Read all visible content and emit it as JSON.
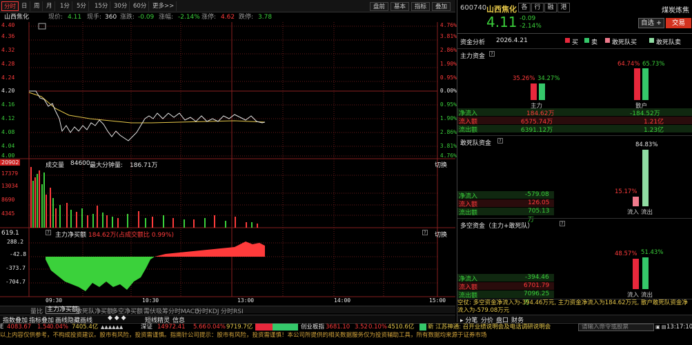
{
  "period_tabs": [
    "分时",
    "日",
    "周",
    "月",
    "1分",
    "5分",
    "15分",
    "30分",
    "60分",
    "更多>>"
  ],
  "period_active": 0,
  "toolbar_right": [
    "盘前",
    "基本",
    "指标",
    "叠加"
  ],
  "info": {
    "name": "山西焦化",
    "price_label": "现价:",
    "price": "4.11",
    "vol_label": "现手:",
    "vol": "360",
    "chg_label": "涨跌:",
    "chg": "-0.09",
    "pct_label": "涨幅:",
    "pct": "-2.14%",
    "up_label": "涨停:",
    "up": "4.62",
    "down_label": "跌停:",
    "down": "3.78"
  },
  "price_axis_left": [
    "4.40",
    "4.36",
    "4.32",
    "4.28",
    "4.24",
    "4.20",
    "4.16",
    "4.12",
    "4.08",
    "4.04",
    "4.00"
  ],
  "price_axis_right": [
    "4.76%",
    "3.81%",
    "2.86%",
    "1.90%",
    "0.95%",
    "0.00%",
    "0.95%",
    "1.90%",
    "2.86%",
    "3.81%",
    "4.76%"
  ],
  "volume_panel": {
    "title_label": "成交量",
    "value": "84600",
    "max_label": "最大分钟量:",
    "max_value": "186.71万",
    "switch": "切换",
    "top_value": "20902",
    "axis": [
      "17379",
      "13034",
      "8690",
      "4345"
    ]
  },
  "flow_panel": {
    "title": "主力净买额",
    "value": "184.62万(占成交额比 0.99%)",
    "switch": "切换",
    "axis": [
      "619.1",
      "288.2",
      "-42.8",
      "-373.7",
      "-704.7"
    ]
  },
  "time_axis": [
    "09:30",
    "10:30",
    "13:00",
    "14:00",
    "15:00"
  ],
  "indicator_tabs": [
    "量比",
    "主力净买额",
    "敢死队净买额",
    "多空净买额",
    "需伏吸筹",
    "分时MACD",
    "分时KDJ",
    "分时RSI"
  ],
  "bottom_tools": [
    "指数叠加",
    "指标叠加",
    "画线",
    "隐藏画线",
    "短线精灵",
    "信息"
  ],
  "ticker": [
    {
      "name": "E",
      "value": "4083.67",
      "chg": "1.54",
      "pct": "0.04%",
      "amt": "7405.4亿"
    },
    {
      "name": "深证",
      "value": "14972.41",
      "chg": "5.66",
      "pct": "0.04%",
      "amt": "9719.7亿"
    },
    {
      "name": "创业板指",
      "value": "3681.10",
      "chg": "3.52",
      "pct": "0.10%",
      "amt": "4510.6亿"
    }
  ],
  "news_ticker": "新 江苏神通: 召开业绩说明会及电话调研说明会",
  "cmd_placeholder": "请输入命令或股票",
  "clock": "13:17:10",
  "disclaimer": "以上内容仅供参考，不构成投资建议。股市有风险，投资需谨慎。指南针公司提示：股市有风险，投资需谨慎！本公司所提供的相关数据服务仅为投资辅助工具，所有数据均来源于证券市场",
  "right": {
    "code": "600740",
    "name": "山西焦化",
    "tabs": [
      "各",
      "行",
      "融",
      "港"
    ],
    "industry": "煤炭炼焦",
    "price": "4.11",
    "chg": "-0.09",
    "pct": "-2.14%",
    "btn_watch": "自选",
    "btn_trade": "交易",
    "analysis_label": "资金分析",
    "date": "2026.4.21",
    "legend": [
      "买",
      "卖",
      "敢死队买",
      "敢死队卖"
    ],
    "section1": {
      "title": "主力资金",
      "left_label": "主力",
      "right_label": "散户",
      "zl_buy": "35.26%",
      "zl_sell": "34.27%",
      "sh_buy": "64.74%",
      "sh_sell": "65.73%",
      "rows": [
        {
          "k": "净流入",
          "v": "184.62万",
          "rv": "-184.52万"
        },
        {
          "k": "流入额",
          "v": "6575.74万",
          "rv": "1.21亿"
        },
        {
          "k": "流出额",
          "v": "6391.12万",
          "rv": "1.23亿"
        }
      ]
    },
    "section2": {
      "title": "敢死队资金",
      "in_pct": "15.17%",
      "out_pct": "84.83%",
      "in_label": "流入",
      "out_label": "流出",
      "rows": [
        {
          "k": "净流入",
          "v": "-579.08万"
        },
        {
          "k": "流入额",
          "v": "126.05万"
        },
        {
          "k": "流出额",
          "v": "705.13万"
        }
      ]
    },
    "section3": {
      "title": "多空资金（主力+敢死队）",
      "in_pct": "48.57%",
      "out_pct": "51.43%",
      "in_label": "流入",
      "out_label": "流出",
      "rows": [
        {
          "k": "净流入",
          "v": "-394.46万"
        },
        {
          "k": "流入额",
          "v": "6701.79万"
        },
        {
          "k": "流出额",
          "v": "7096.25万"
        }
      ]
    },
    "summary": "空仗: 多空资金净流入为-394.46万元, 主力资金净流入为184.62万元, 散户敢死队资金净流入为-579.08万元",
    "bottom_tabs": [
      "分笔",
      "分价",
      "盘口",
      "财务"
    ]
  },
  "colors": {
    "up": "#ff3b3b",
    "down": "#3bd13b",
    "avg": "#e8c94a",
    "price": "#e8e8e8"
  }
}
